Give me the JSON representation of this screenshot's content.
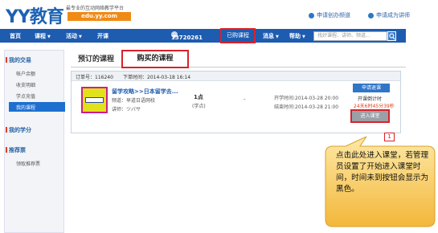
{
  "header": {
    "logo": "YY教育",
    "slogan": "最专业的互动网络教学平台",
    "url": "edu.yy.com",
    "links": [
      "申请创办频道",
      "申请成为讲师"
    ]
  },
  "nav": {
    "items": [
      "首页",
      "课程",
      "活动",
      "开课"
    ],
    "user": "13720261",
    "highlight_button": "已购课程",
    "messages": "消息",
    "help": "帮助",
    "search_placeholder": "找好课程、讲师、频道..."
  },
  "sidebar": {
    "section1": "我的交易",
    "items": [
      "帐户余额",
      "收支明细",
      "学点充值",
      "我的课程"
    ],
    "section2": "我的学分",
    "section3": "推荐票",
    "item_last": "领取推荐票"
  },
  "tabs": [
    "预订的课程",
    "购买的课程"
  ],
  "order": {
    "order_no": "订单号：116240",
    "order_time": "下单时间：2014-03-18 16:14",
    "course_name": "留学攻略>>日本留学去...",
    "channel": "频道：早道日语网校",
    "teacher": "讲师：ツバサ",
    "points": "1点",
    "points_unit": "(学点)",
    "dash": "-",
    "start": "开学时间:2014-03-28 20:00",
    "end": "结束时间:2014-03-28 21:00",
    "apply_button": "申请退课",
    "countdown_label": "开课倒计时",
    "countdown": "24天6时45分39秒",
    "enter_button": "进入课堂"
  },
  "badge": "1",
  "callout": "点击此处进入课堂，若管理员设置了开始进入课堂时间，时间未到按钮会显示为黑色。"
}
